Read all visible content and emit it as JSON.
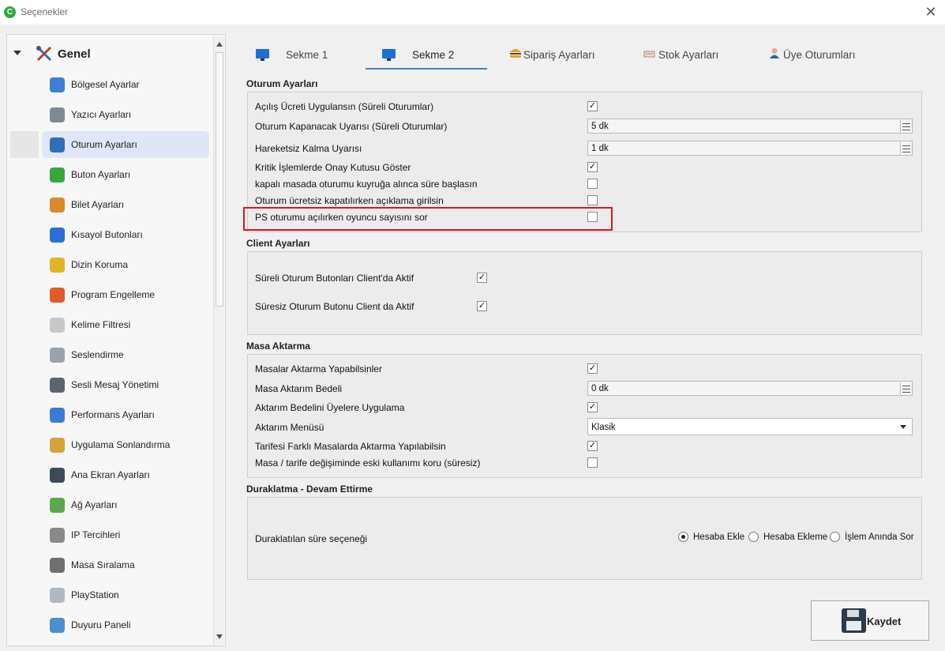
{
  "window": {
    "title": "Seçenekler",
    "app_icon": "C"
  },
  "tree": {
    "root_label": "Genel",
    "items": [
      {
        "label": "Bölgesel Ayarlar",
        "icon": "regional-settings-icon",
        "color": "#3b7fd6"
      },
      {
        "label": "Yazıcı Ayarları",
        "icon": "printer-icon",
        "color": "#7d8a96"
      },
      {
        "label": "Oturum Ayarları",
        "icon": "tools-icon",
        "color": "#2f6fb8",
        "selected": true
      },
      {
        "label": "Buton Ayarları",
        "icon": "check-circle-icon",
        "color": "#35a83a"
      },
      {
        "label": "Bilet Ayarları",
        "icon": "ticket-icon",
        "color": "#d98a2b"
      },
      {
        "label": "Kısayol Butonları",
        "icon": "play-icon",
        "color": "#2a6fd8"
      },
      {
        "label": "Dizin Koruma",
        "icon": "folder-check-icon",
        "color": "#e2b526"
      },
      {
        "label": "Program Engelleme",
        "icon": "block-icon",
        "color": "#e05a2a"
      },
      {
        "label": "Kelime Filtresi",
        "icon": "word-filter-icon",
        "color": "#c8c8c8"
      },
      {
        "label": "Seslendirme",
        "icon": "speaker-icon",
        "color": "#9aa3ab"
      },
      {
        "label": "Sesli Mesaj Yönetimi",
        "icon": "headset-icon",
        "color": "#5a6570"
      },
      {
        "label": "Performans Ayarları",
        "icon": "chart-icon",
        "color": "#3a7bd5"
      },
      {
        "label": "Uygulama Sonlandırma",
        "icon": "broom-icon",
        "color": "#d8a23a"
      },
      {
        "label": "Ana Ekran Ayarları",
        "icon": "desktop-icon",
        "color": "#3d4a57"
      },
      {
        "label": "Ağ Ayarları",
        "icon": "network-icon",
        "color": "#5aa84a"
      },
      {
        "label": "IP Tercihleri",
        "icon": "ip-icon",
        "color": "#8a8a8a"
      },
      {
        "label": "Masa Sıralama",
        "icon": "grid-icon",
        "color": "#6f6f6f"
      },
      {
        "label": "PlayStation",
        "icon": "gamepad-icon",
        "color": "#b0b8c0"
      },
      {
        "label": "Duyuru Paneli",
        "icon": "envelope-icon",
        "color": "#4a8fd0"
      }
    ]
  },
  "tabs": [
    {
      "label": "Sekme 1",
      "icon": "monitor-icon",
      "active": false
    },
    {
      "label": "Sekme 2",
      "icon": "monitor-icon",
      "active": true
    },
    {
      "label": "Sipariş Ayarları",
      "icon": "burger-icon",
      "active": false
    },
    {
      "label": "Stok Ayarları",
      "icon": "stock-icon",
      "active": false
    },
    {
      "label": "Üye Oturumları",
      "icon": "user-icon",
      "active": false
    }
  ],
  "oturum": {
    "title": "Oturum Ayarları",
    "rows": [
      {
        "label": "Açılış Ücreti Uygulansın (Süreli Oturumlar)",
        "checked": true
      },
      {
        "label": "Oturum Kapanacak Uyarısı (Süreli Oturumlar)",
        "value": "5 dk"
      },
      {
        "label": "Hareketsiz Kalma Uyarısı",
        "value": "1 dk"
      },
      {
        "label": "Kritik İşlemlerde Onay Kutusu Göster",
        "checked": true
      },
      {
        "label": "kapalı masada oturumu kuyruğa alınca süre başlasın",
        "checked": false
      },
      {
        "label": "Oturum ücretsiz kapatılırken açıklama girilsin",
        "checked": false
      },
      {
        "label": "PS oturumu açılırken oyuncu sayısını sor",
        "checked": false
      }
    ]
  },
  "client": {
    "title": "Client Ayarları",
    "rows": [
      {
        "label": "Süreli Oturum Butonları Client'da Aktif",
        "checked": true
      },
      {
        "label": "Süresiz Oturum Butonu Client da Aktif",
        "checked": true
      }
    ]
  },
  "masa": {
    "title": "Masa Aktarma",
    "rows": [
      {
        "label": "Masalar Aktarma Yapabilsinler",
        "checked": true
      },
      {
        "label": "Masa Aktarım Bedeli",
        "value": "0 dk"
      },
      {
        "label": "Aktarım Bedelini Üyelere Uygulama",
        "checked": true
      },
      {
        "label": "Aktarım Menüsü",
        "value": "Klasik"
      },
      {
        "label": "Tarifesi Farklı Masalarda Aktarma Yapılabilsin",
        "checked": true
      },
      {
        "label": "Masa / tarife değişiminde eski kullanımı koru (süresiz)",
        "checked": false
      }
    ]
  },
  "duraklatma": {
    "title": "Duraklatma - Devam Ettirme",
    "label": "Duraklatılan süre seçeneği",
    "options": [
      {
        "label": "Hesaba Ekle",
        "selected": true
      },
      {
        "label": "Hesaba Ekleme",
        "selected": false
      },
      {
        "label": "İşlem Anında Sor",
        "selected": false
      }
    ]
  },
  "save_label": "Kaydet",
  "colors": {
    "highlight": "#e0141e",
    "tab_underline": "#4a7dc4",
    "selected_item": "#dfe6f7"
  }
}
